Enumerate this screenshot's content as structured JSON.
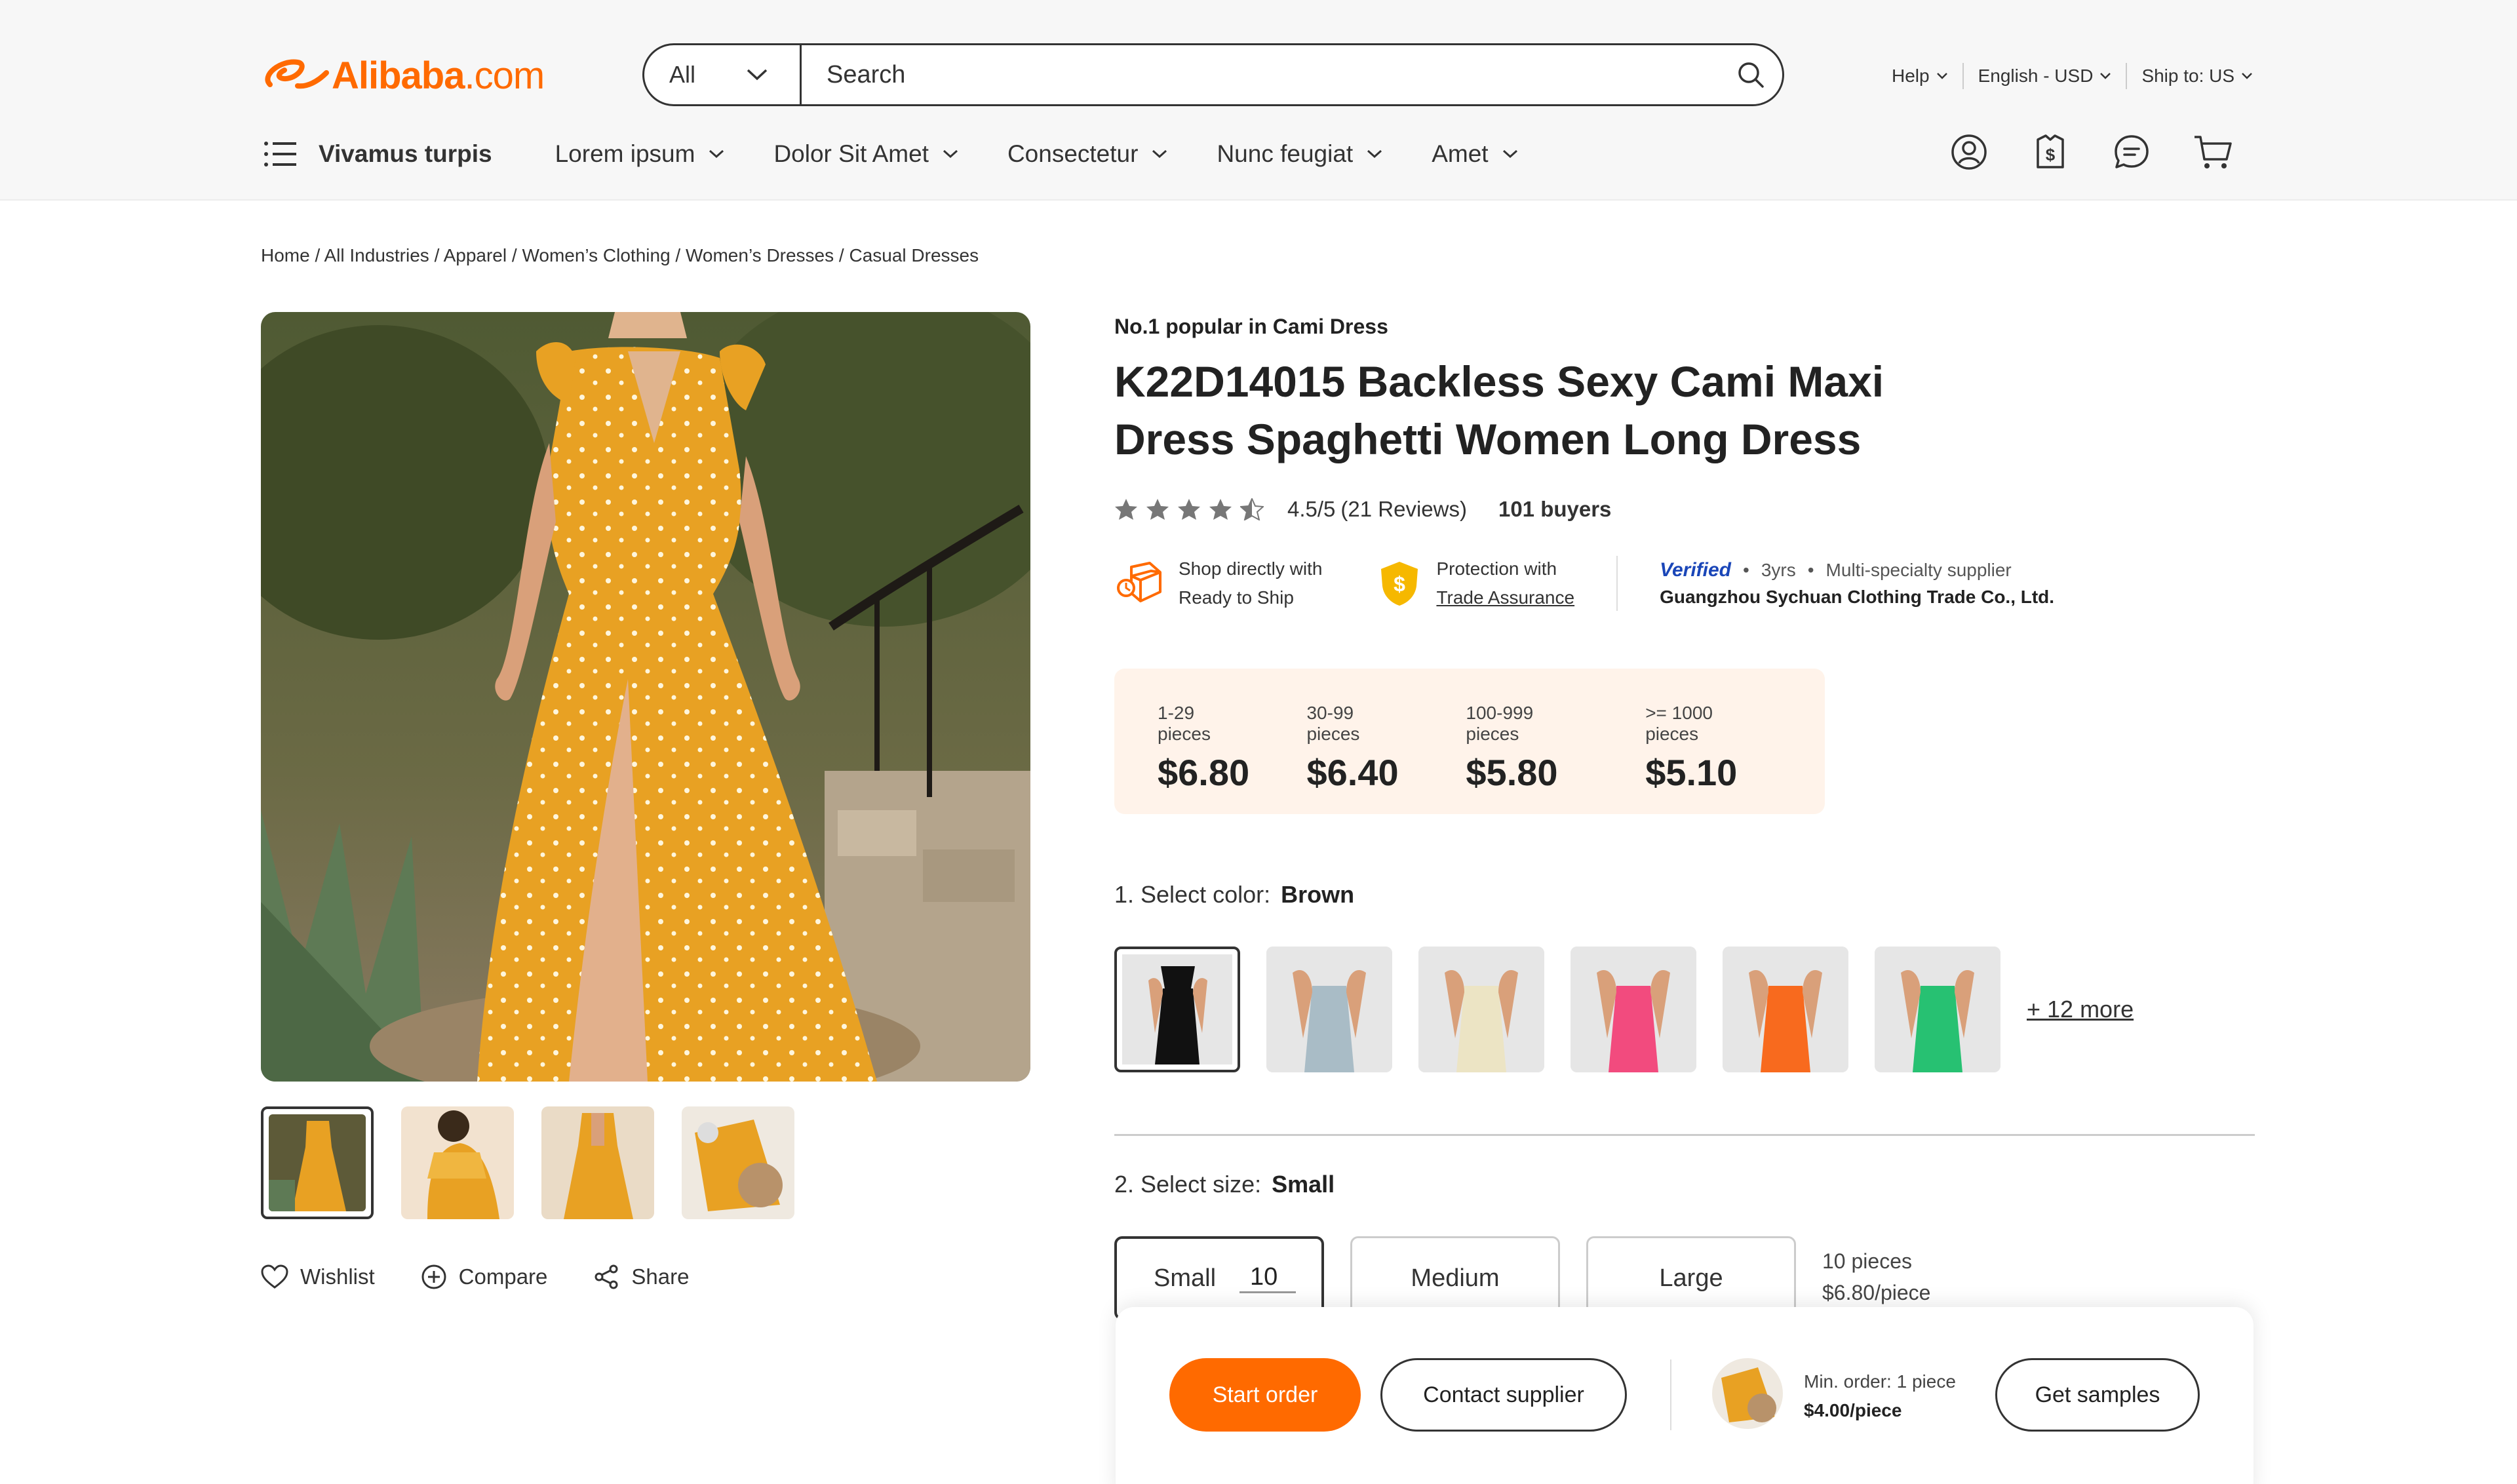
{
  "header": {
    "logo": {
      "brand": "Alibaba",
      "suffix": ".com"
    },
    "search": {
      "category": "All",
      "placeholder": "Search"
    },
    "utility": {
      "help": "Help",
      "language": "English - USD",
      "ship_to": "Ship to: US"
    },
    "nav": {
      "all_categories": "Vivamus turpis",
      "items": [
        "Lorem ipsum",
        "Dolor Sit Amet",
        "Consectetur",
        "Nunc feugiat",
        "Amet"
      ]
    },
    "icons": [
      "account-icon",
      "orders-icon",
      "messages-icon",
      "cart-icon"
    ]
  },
  "breadcrumb": [
    "Home",
    "All Industries",
    "Apparel",
    "Women’s Clothing",
    "Women’s Dresses",
    "Casual Dresses"
  ],
  "gallery": {
    "actions": {
      "wishlist": "Wishlist",
      "compare": "Compare",
      "share": "Share"
    }
  },
  "product": {
    "badge": "No.1 popular in Cami Dress",
    "title": "K22D14015 Backless Sexy Cami Maxi Dress Spaghetti Women Long Dress",
    "rating": {
      "score": "4.5/5",
      "reviews": "(21 Reviews)",
      "buyers": "101 buyers",
      "stars": 4.5
    },
    "features": {
      "ready_line1": "Shop directly with",
      "ready_line2": "Ready to Ship",
      "protect_line1": "Protection with",
      "protect_line2": "Trade Assurance"
    },
    "supplier": {
      "verified": "Verified",
      "years": "3yrs",
      "type": "Multi-specialty supplier",
      "name": "Guangzhou Sychuan Clothing Trade Co., Ltd."
    },
    "price_tiers": [
      {
        "qty": "1-29 pieces",
        "price": "$6.80"
      },
      {
        "qty": "30-99 pieces",
        "price": "$6.40"
      },
      {
        "qty": "100-999 pieces",
        "price": "$5.80"
      },
      {
        "qty": ">= 1000 pieces",
        "price": "$5.10"
      }
    ],
    "color": {
      "label": "1. Select color:",
      "selected": "Brown",
      "swatches": [
        "#111111",
        "#a9bcc6",
        "#ece4c4",
        "#f24b7e",
        "#f86a1e",
        "#27c172"
      ],
      "more": "+ 12 more"
    },
    "size": {
      "label": "2. Select size:",
      "selected": "Small",
      "options": [
        "Small",
        "Medium",
        "Large"
      ],
      "qty": "10",
      "summary_qty": "10 pieces",
      "summary_price": "$6.80/piece"
    }
  },
  "order_panel": {
    "start_order": "Start order",
    "contact_supplier": "Contact supplier",
    "min_order": "Min. order: 1 piece",
    "sample_price": "$4.00/piece",
    "get_samples": "Get samples"
  },
  "colors": {
    "accent": "#ff6a00",
    "price_bg": "#fff3ea",
    "dress": "#e8a123"
  }
}
